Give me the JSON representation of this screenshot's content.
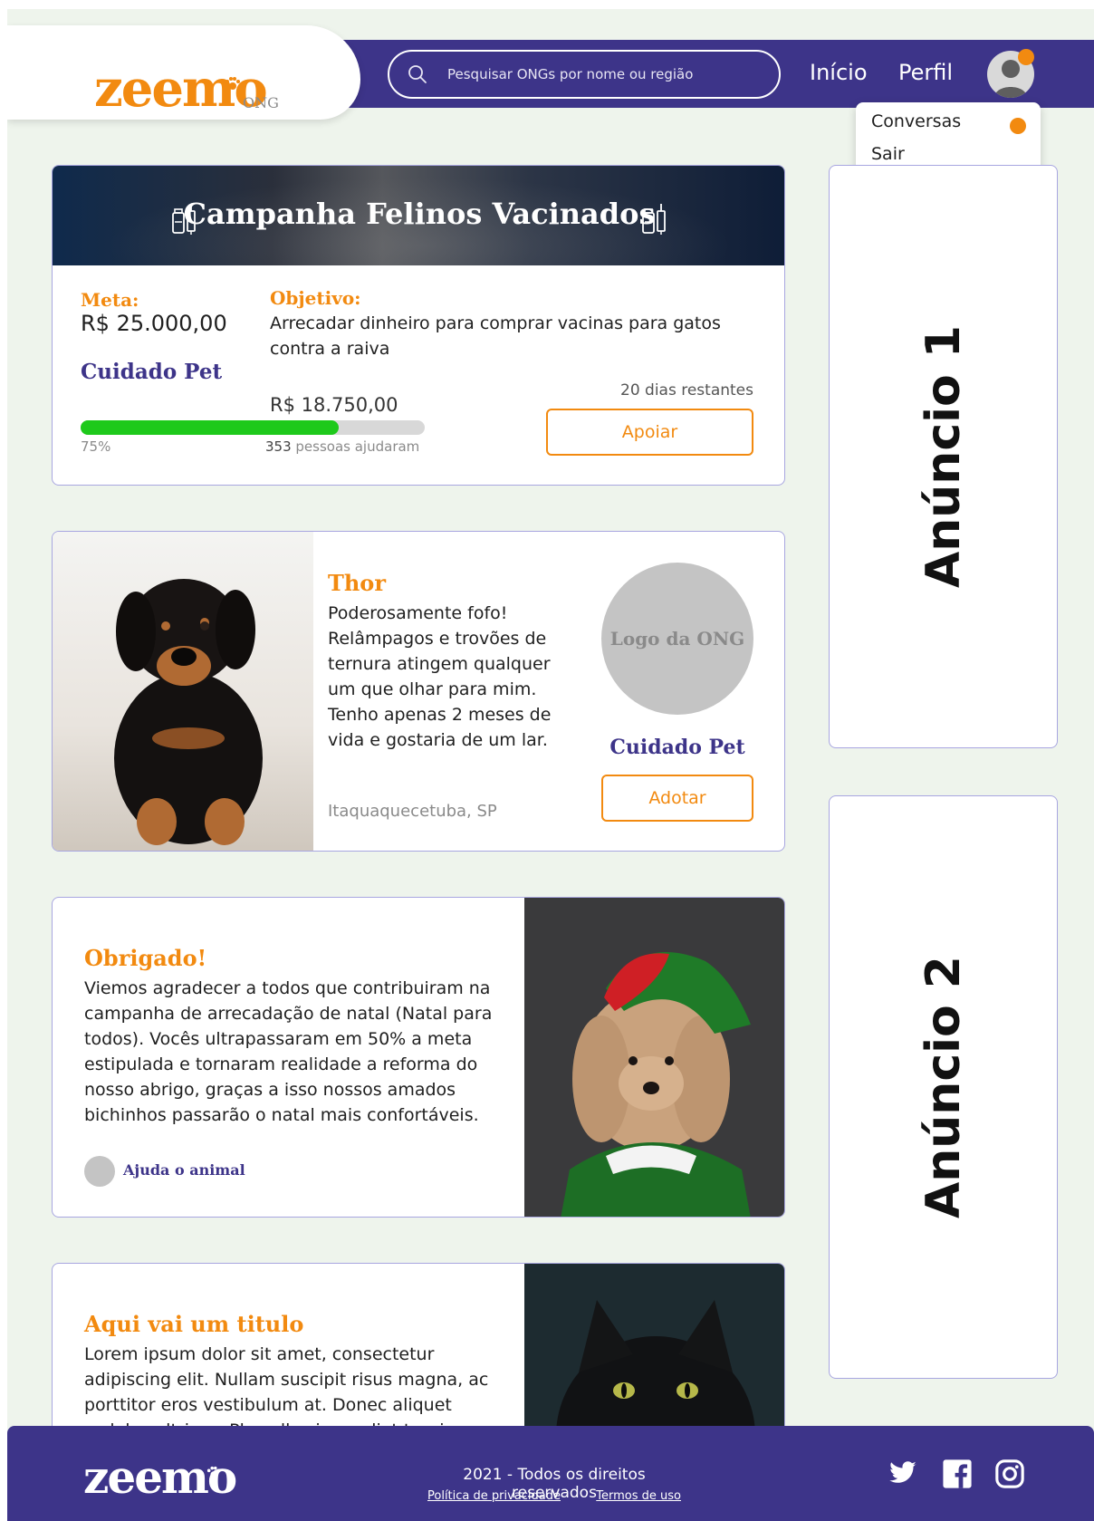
{
  "header": {
    "logo": "zeemo",
    "logo_sub": "ONG",
    "search_placeholder": "Pesquisar ONGs por nome ou região",
    "nav": {
      "home": "Início",
      "profile": "Perfil"
    },
    "menu": {
      "conversations": "Conversas",
      "logout": "Sair"
    }
  },
  "campaign": {
    "title": "Campanha Felinos Vacinados",
    "goal_label": "Meta:",
    "goal_value": "R$ 25.000,00",
    "objective_label": "Objetivo:",
    "objective_text": "Arrecadar dinheiro para comprar vacinas para gatos contra a raiva",
    "ngo": "Cuidado Pet",
    "raised": "R$ 18.750,00",
    "progress_percent": 75,
    "progress_label": "75%",
    "helpers_count": "353",
    "helpers_text": " pessoas ajudaram",
    "days_left": "20 dias restantes",
    "cta": "Apoiar"
  },
  "pet": {
    "name": "Thor",
    "description": "Poderosamente fofo! Relâmpagos e trovões de ternura atingem qualquer um que olhar para mim. Tenho apenas 2 meses de vida e gostaria de um lar.",
    "location": "Itaquaquecetuba, SP",
    "ngo_logo": "Logo da ONG",
    "ngo": "Cuidado Pet",
    "cta": "Adotar"
  },
  "post": {
    "title": "Obrigado!",
    "text": "Viemos agradecer a todos que contribuiram na campanha de arrecadação de natal (Natal para todos). Vocês ultrapassaram em 50% a meta estipulada e tornaram realidade a reforma do nosso abrigo, graças a isso nossos amados bichinhos passarão o natal mais confortáveis.",
    "author": "Ajuda o animal"
  },
  "post2": {
    "title": "Aqui vai um titulo",
    "text": "Lorem ipsum dolor sit amet, consectetur adipiscing elit. Nullam suscipit risus magna, ac porttitor eros vestibulum at. Donec aliquet sodales ultrices. Phasellus imperdiet turpis"
  },
  "ads": {
    "ad1": "Anúncio 1",
    "ad2": "Anúncio 2"
  },
  "footer": {
    "logo": "zeemo",
    "copyright": "2021 - Todos os direitos reservados",
    "privacy": "Política de privacidade",
    "terms": "Termos de uso"
  },
  "colors": {
    "brand_purple": "#3d3489",
    "brand_orange": "#f28a10",
    "progress_green": "#1ec91b",
    "background": "#eef4ec"
  },
  "icons": [
    "search-icon",
    "paw-icon",
    "vaccine-icon",
    "user-icon",
    "twitter-icon",
    "facebook-icon",
    "instagram-icon"
  ]
}
